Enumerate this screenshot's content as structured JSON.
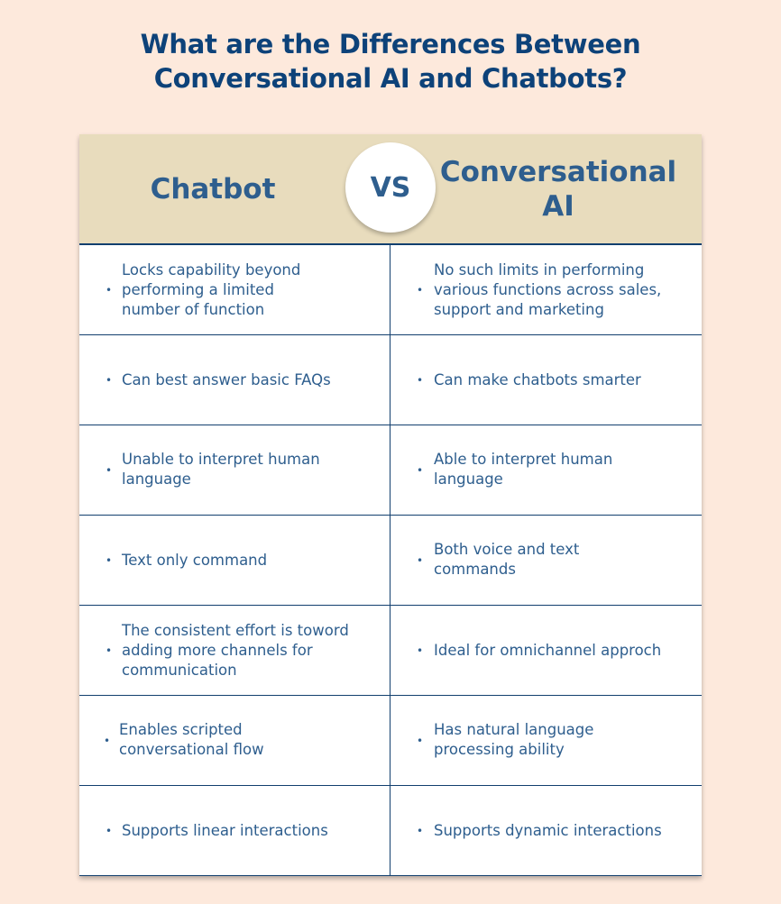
{
  "title": {
    "line1": "What are the Differences Between",
    "line2": "Conversational AI and Chatbots?"
  },
  "colors": {
    "background": "#fde9dc",
    "header_band": "#e8dcbd",
    "title_text": "#0d4279",
    "body_text": "#2e5e8e",
    "grid_lines": "#123f6e"
  },
  "header": {
    "left": "Chatbot",
    "vs": "VS",
    "right_line1": "Conversational",
    "right_line2": "AI"
  },
  "rows": [
    {
      "chatbot": "Locks capability beyond performing a limited number of function",
      "conversational_ai": "No such limits in performing various functions across sales, support and marketing"
    },
    {
      "chatbot": "Can best answer basic FAQs",
      "conversational_ai": "Can make chatbots smarter"
    },
    {
      "chatbot": "Unable to interpret human language",
      "conversational_ai": "Able to interpret human language"
    },
    {
      "chatbot": "Text only command",
      "conversational_ai": "Both voice and text commands"
    },
    {
      "chatbot": "The consistent effort is toword adding more channels for communication",
      "conversational_ai": "Ideal for omnichannel approch"
    },
    {
      "chatbot": "Enables scripted conversational flow",
      "conversational_ai": "Has natural language processing ability"
    },
    {
      "chatbot": "Supports linear interactions",
      "conversational_ai": "Supports dynamic interactions"
    }
  ],
  "bullet_glyph": "•"
}
